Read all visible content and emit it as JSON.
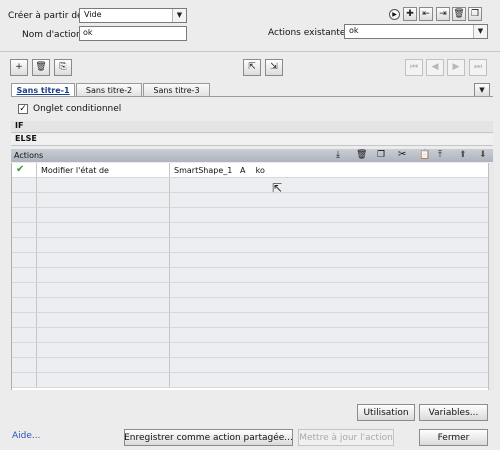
{
  "header": {
    "create_from_label": "Créer à partir de:",
    "create_from_value": "Vide",
    "action_name_label": "Nom d'action:",
    "action_name_value": "ok",
    "existing_actions_label": "Actions existantes:",
    "existing_actions_value": "ok"
  },
  "tabs": [
    {
      "label": "Sans titre-1"
    },
    {
      "label": "Sans titre-2"
    },
    {
      "label": "Sans titre-3"
    }
  ],
  "conditional": {
    "label": "Onglet conditionnel",
    "checked": true
  },
  "sections": {
    "if": "IF",
    "else": "ELSE",
    "actions": "Actions"
  },
  "actions_table": {
    "rows": [
      {
        "status": "✔",
        "action": "Modifier l'état de",
        "target": "SmartShape_1   A    ko"
      }
    ]
  },
  "buttons": {
    "usage": "Utilisation",
    "variables": "Variables...",
    "help": "Aide...",
    "save_shared": "Enregistrer comme action partagée...",
    "update_action": "Mettre à jour l'action",
    "close": "Fermer"
  },
  "colors": {
    "accent_link": "#2a56b8",
    "check_green": "#2f9e2f"
  }
}
